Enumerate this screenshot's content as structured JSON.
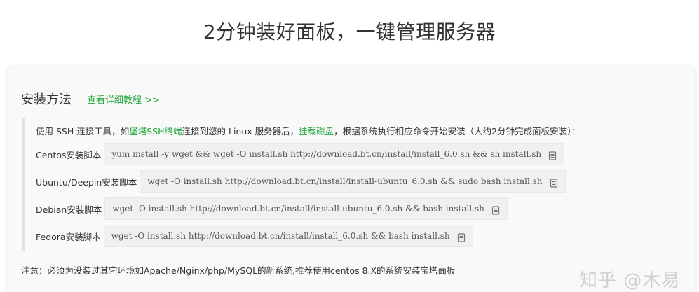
{
  "headline": "2分钟装好面板，一键管理服务器",
  "card": {
    "title": "安装方法",
    "detail_link": "查看详细教程 >>",
    "intro": {
      "part1": "使用 SSH 连接工具，如",
      "link1": "堡塔SSH终端",
      "part2": "连接到您的 Linux 服务器后，",
      "link2": "挂载磁盘",
      "part3": "，根据系统执行相应命令开始安装（大约2分钟完成面板安装）："
    },
    "scripts": [
      {
        "label": "Centos安装脚本",
        "command": "yum install -y wget && wget -O install.sh http://download.bt.cn/install/install_6.0.sh && sh install.sh"
      },
      {
        "label": "Ubuntu/Deepin安装脚本",
        "command": "wget -O install.sh http://download.bt.cn/install/install-ubuntu_6.0.sh && sudo bash install.sh"
      },
      {
        "label": "Debian安装脚本",
        "command": "wget -O install.sh http://download.bt.cn/install/install-ubuntu_6.0.sh && bash install.sh"
      },
      {
        "label": "Fedora安装脚本",
        "command": "wget -O install.sh http://download.bt.cn/install/install_6.0.sh && bash install.sh"
      }
    ],
    "note": "注意：必须为没装过其它环境如Apache/Nginx/php/MySQL的新系统,推荐使用centos 8.X的系统安装宝塔面板"
  },
  "watermark": "知乎 @木易",
  "colors": {
    "accent": "#20a53a",
    "card_bg": "#f9f9f9",
    "cmd_bg": "#f0f0f0"
  },
  "icons": {
    "copy": "copy-icon"
  }
}
